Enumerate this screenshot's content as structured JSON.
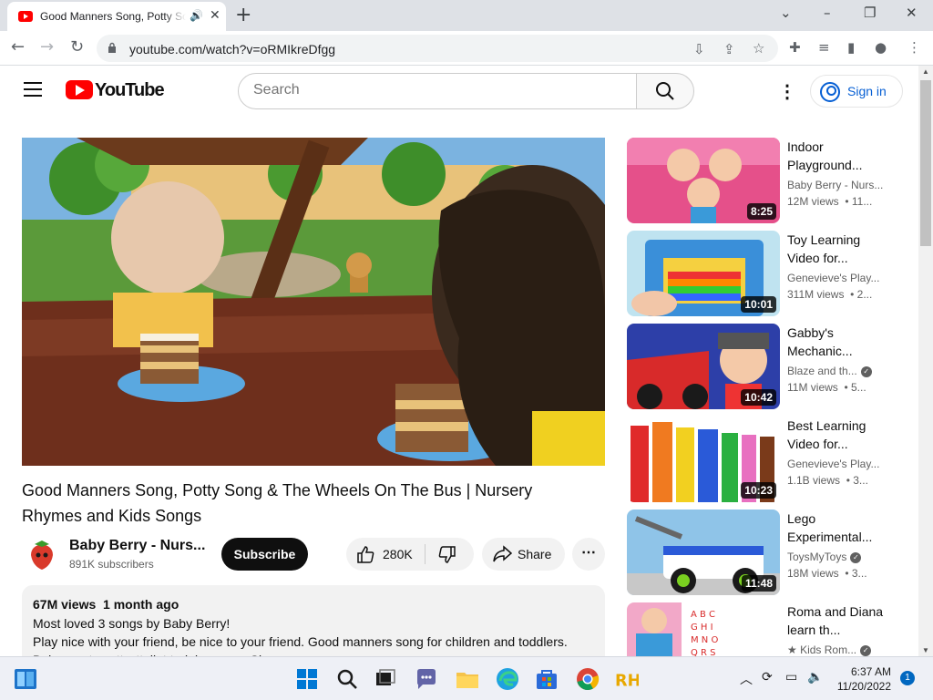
{
  "browser": {
    "tab_title": "Good Manners Song, Potty Song & The Wheels On The Bus | Nursery Rhymes and Kids Songs",
    "url": "youtube.com/watch?v=oRMIkreDfgg"
  },
  "header": {
    "logo_text": "YouTube",
    "search_placeholder": "Search",
    "signin_label": "Sign in"
  },
  "video": {
    "title": "Good Manners Song, Potty Song & The Wheels On The Bus | Nursery Rhymes and Kids Songs",
    "channel": "Baby Berry - Nurs...",
    "subscribers": "891K subscribers",
    "subscribe_label": "Subscribe",
    "likes": "280K",
    "share_label": "Share",
    "views_age": "67M views  1 month ago",
    "description_lines": [
      "Most loved 3 songs by Baby Berry!",
      "Play nice with your friend, be nice to your friend. Good manners song for children and toddlers.",
      "Baby wants potty, ttoilet training song. Sh..."
    ]
  },
  "recommendations": [
    {
      "title": "Indoor Playground...",
      "channel": "Baby Berry - Nurs...",
      "views": "12M views  • 11...",
      "duration": "8:25",
      "verified": false
    },
    {
      "title": "Toy Learning Video for...",
      "channel": "Genevieve's Play...",
      "views": "311M views  • 2...",
      "duration": "10:01",
      "verified": false
    },
    {
      "title": "Gabby's Mechanic...",
      "channel": "Blaze and th...",
      "views": "11M views  • 5...",
      "duration": "10:42",
      "verified": true
    },
    {
      "title": "Best Learning Video for...",
      "channel": "Genevieve's Play...",
      "views": "1.1B views  • 3...",
      "duration": "10:23",
      "verified": false
    },
    {
      "title": "Lego Experimental...",
      "channel": "ToysMyToys",
      "views": "18M views  • 3...",
      "duration": "11:48",
      "verified": true
    },
    {
      "title": "Roma and Diana learn th...",
      "channel": "★ Kids Rom...",
      "views": "",
      "duration": "",
      "verified": true
    }
  ],
  "taskbar": {
    "time": "6:37 AM",
    "date": "11/20/2022",
    "notifications": "1"
  },
  "colors": {
    "youtube_red": "#ff0000",
    "link_blue": "#065fd4",
    "text": "#0f0f0f",
    "secondary_text": "#606060"
  }
}
